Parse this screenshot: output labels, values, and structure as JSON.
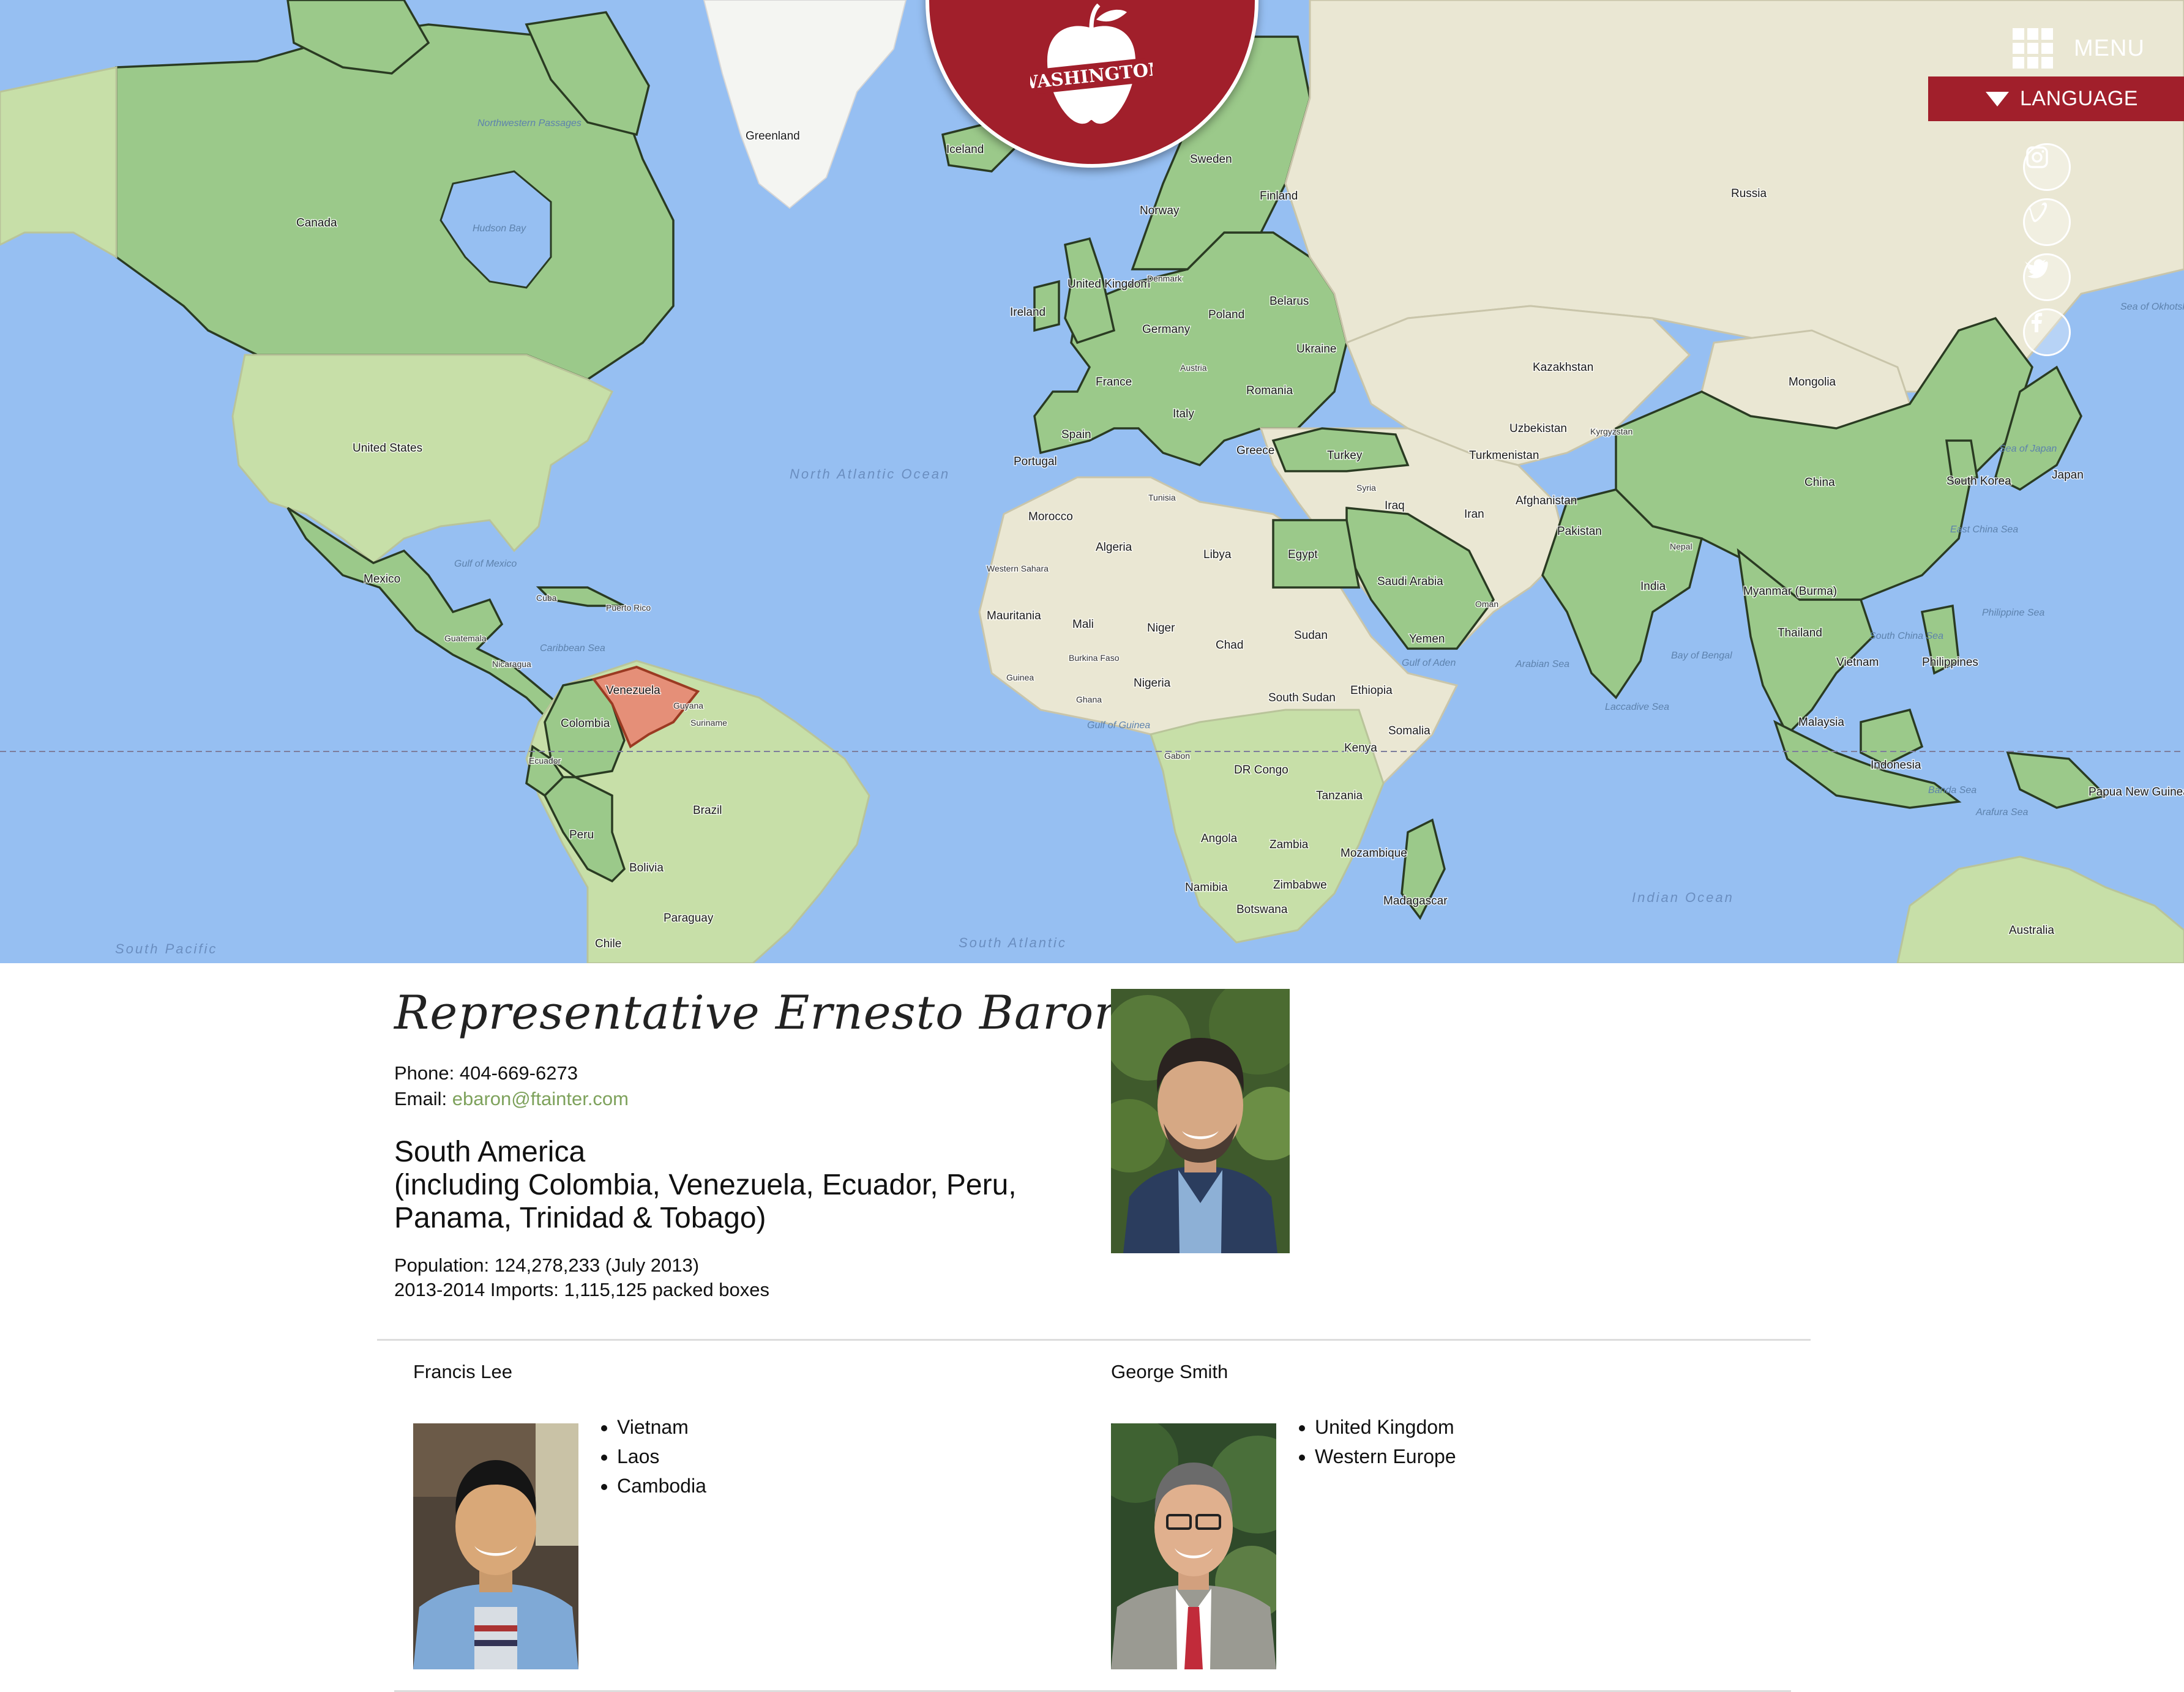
{
  "brand": {
    "logo_text": "WASHINGTON",
    "color": "#a11f2b"
  },
  "nav": {
    "menu_label": "MENU",
    "language_label": "LANGUAGE",
    "social": [
      "instagram-icon",
      "vimeo-icon",
      "twitter-icon",
      "facebook-icon"
    ]
  },
  "map": {
    "highlighted_country": "Venezuela",
    "highlight_color": "#e58f78",
    "active_color": "#9bc98a",
    "labels": {
      "greenland": "Greenland",
      "iceland": "Iceland",
      "sweden": "Sweden",
      "finland": "Finland",
      "norway": "Norway",
      "russia": "Russia",
      "canada": "Canada",
      "hudson_bay": "Hudson Bay",
      "nw_passages": "Northwestern Passages",
      "united_states": "United States",
      "mexico": "Mexico",
      "gulf_of_mexico": "Gulf of Mexico",
      "cuba": "Cuba",
      "puerto_rico": "Puerto Rico",
      "caribbean_sea": "Caribbean Sea",
      "guatemala": "Guatemala",
      "nicaragua": "Nicaragua",
      "venezuela": "Venezuela",
      "colombia": "Colombia",
      "guyana": "Guyana",
      "suriname": "Suriname",
      "ecuador": "Ecuador",
      "peru": "Peru",
      "brazil": "Brazil",
      "bolivia": "Bolivia",
      "paraguay": "Paraguay",
      "chile": "Chile",
      "north_atlantic_ocean": "North Atlantic Ocean",
      "south_atlantic": "South Atlantic",
      "south_pacific": "South Pacific",
      "united_kingdom": "United Kingdom",
      "ireland": "Ireland",
      "france": "France",
      "spain": "Spain",
      "portugal": "Portugal",
      "germany": "Germany",
      "poland": "Poland",
      "belarus": "Belarus",
      "ukraine": "Ukraine",
      "austria": "Austria",
      "romania": "Romania",
      "italy": "Italy",
      "greece": "Greece",
      "denmark": "Denmark",
      "turkey": "Turkey",
      "kazakhstan": "Kazakhstan",
      "mongolia": "Mongolia",
      "china": "China",
      "uzbekistan": "Uzbekistan",
      "kyrgyzstan": "Kyrgyzstan",
      "turkmenistan": "Turkmenistan",
      "afghanistan": "Afghanistan",
      "pakistan": "Pakistan",
      "iran": "Iran",
      "iraq": "Iraq",
      "syria": "Syria",
      "saudi_arabia": "Saudi Arabia",
      "oman": "Oman",
      "yemen": "Yemen",
      "egypt": "Egypt",
      "libya": "Libya",
      "algeria": "Algeria",
      "morocco": "Morocco",
      "tunisia": "Tunisia",
      "western_sahara": "Western Sahara",
      "mauritania": "Mauritania",
      "mali": "Mali",
      "niger": "Niger",
      "chad": "Chad",
      "sudan": "Sudan",
      "south_sudan": "South Sudan",
      "ethiopia": "Ethiopia",
      "somalia": "Somalia",
      "kenya": "Kenya",
      "nigeria": "Nigeria",
      "ghana": "Ghana",
      "guinea": "Guinea",
      "burkina_faso": "Burkina Faso",
      "gabon": "Gabon",
      "dr_congo": "DR Congo",
      "tanzania": "Tanzania",
      "angola": "Angola",
      "zambia": "Zambia",
      "mozambique": "Mozambique",
      "namibia": "Namibia",
      "zimbabwe": "Zimbabwe",
      "botswana": "Botswana",
      "madagascar": "Madagascar",
      "gulf_of_guinea": "Gulf of Guinea",
      "gulf_of_aden": "Gulf of Aden",
      "arabian_sea": "Arabian Sea",
      "india": "India",
      "nepal": "Nepal",
      "bay_of_bengal": "Bay of Bengal",
      "laccadive_sea": "Laccadive Sea",
      "myanmar": "Myanmar (Burma)",
      "thailand": "Thailand",
      "vietnam": "Vietnam",
      "malaysia": "Malaysia",
      "indonesia": "Indonesia",
      "philippines": "Philippines",
      "south_korea": "South Korea",
      "japan": "Japan",
      "sea_of_japan": "Sea of Japan",
      "east_china_sea": "East China Sea",
      "south_china_sea": "South China Sea",
      "philippine_sea": "Philippine Sea",
      "sea_of_okhotsk": "Sea of Okhotsk",
      "papua_new_guinea": "Papua New Guinea",
      "australia": "Australia",
      "indian_ocean": "Indian Ocean",
      "banda_sea": "Banda Sea",
      "arafura_sea": "Arafura Sea"
    }
  },
  "representative": {
    "title": "Representative Ernesto Baron",
    "phone_label": "Phone:",
    "phone": "404-669-6273",
    "email_label": "Email:",
    "email": "ebaron@ftainter.com",
    "region_line1": "South America",
    "region_line2": "(including Colombia, Venezuela, Ecuador, Peru,",
    "region_line3": "Panama, Trinidad & Tobago)",
    "population": "Population: 124,278,233 (July 2013)",
    "imports": "2013-2014 Imports: 1,115,125 packed boxes"
  },
  "others": [
    {
      "name": "Francis Lee",
      "countries": [
        "Vietnam",
        "Laos",
        "Cambodia"
      ]
    },
    {
      "name": "George Smith",
      "countries": [
        "United Kingdom",
        "Western Europe"
      ]
    }
  ]
}
